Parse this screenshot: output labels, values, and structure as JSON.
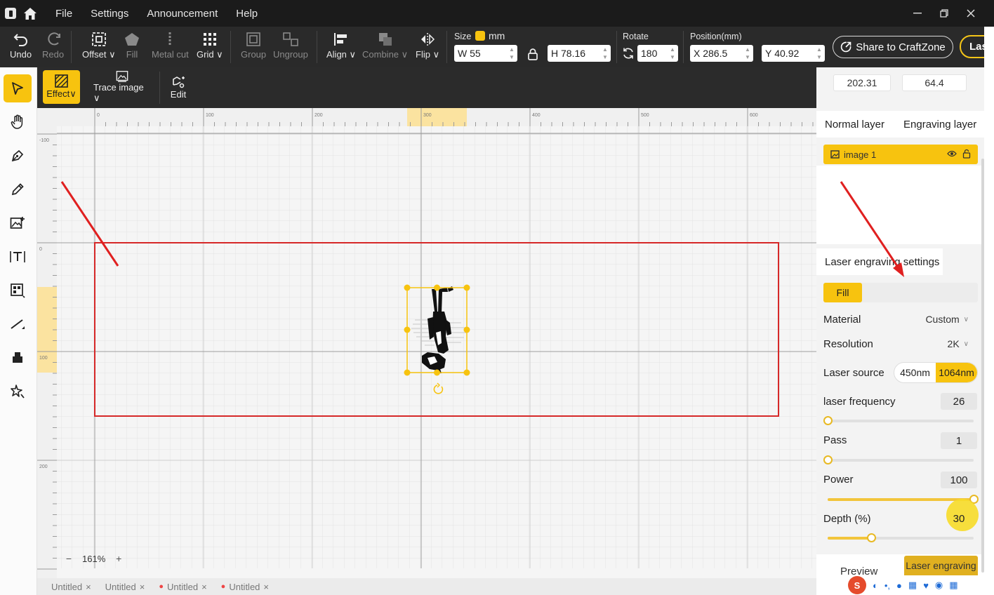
{
  "menu": {
    "items": [
      "File",
      "Settings",
      "Announcement",
      "Help"
    ]
  },
  "toolbar": {
    "undo": "Undo",
    "redo": "Redo",
    "offset": "Offset",
    "fill": "Fill",
    "metal_cut": "Metal cut",
    "grid": "Grid",
    "group": "Group",
    "ungroup": "Ungroup",
    "align": "Align",
    "combine": "Combine",
    "flip": "Flip",
    "size_label": "Size",
    "size_unit": "mm",
    "width_prefix": "W",
    "width_value": "55",
    "height_prefix": "H",
    "height_value": "78.16",
    "rotate_label": "Rotate",
    "rotate_value": "180",
    "position_label": "Position(mm)",
    "x_prefix": "X",
    "x_value": "286.5",
    "y_prefix": "Y",
    "y_value": "40.92",
    "share_label": "Share to CraftZone",
    "laser_label": "Las"
  },
  "subtoolbar": {
    "effect": "Effect",
    "trace_image": "Trace image",
    "edit": "Edit"
  },
  "canvas": {
    "ruler_top": [
      "0",
      "100",
      "200",
      "300",
      "400",
      "500",
      "600"
    ],
    "ruler_left": [
      "-100",
      "0",
      "100",
      "200"
    ],
    "zoom": "161%"
  },
  "tabs": [
    {
      "label": "Untitled",
      "dirty": false
    },
    {
      "label": "Untitled",
      "dirty": false
    },
    {
      "label": "Untitled",
      "dirty": true
    },
    {
      "label": "Untitled",
      "dirty": true
    }
  ],
  "panel": {
    "perimeter_value": "202.31",
    "diameter_value": "64.4",
    "layer_tab_normal": "Normal layer",
    "layer_tab_engraving": "Engraving layer",
    "layer_name": "image 1",
    "settings_title": "Laser engraving settings",
    "mode_fill": "Fill",
    "material_label": "Material",
    "material_value": "Custom",
    "resolution_label": "Resolution",
    "resolution_value": "2K",
    "laser_source_label": "Laser source",
    "source_450": "450nm",
    "source_1064": "1064nm",
    "frequency_label": "laser frequency",
    "frequency_value": "26",
    "frequency_fraction": 0.0,
    "pass_label": "Pass",
    "pass_value": "1",
    "pass_fraction": 0.0,
    "power_label": "Power",
    "power_value": "100",
    "power_fraction": 1.0,
    "depth_label": "Depth (%)",
    "depth_value": "30",
    "depth_fraction": 0.3,
    "preview_label": "Preview",
    "engrave_label": "Laser engraving"
  },
  "colors": {
    "accent": "#f7c30f",
    "work_area": "#d62828",
    "toolbar": "#2a2a2a"
  }
}
